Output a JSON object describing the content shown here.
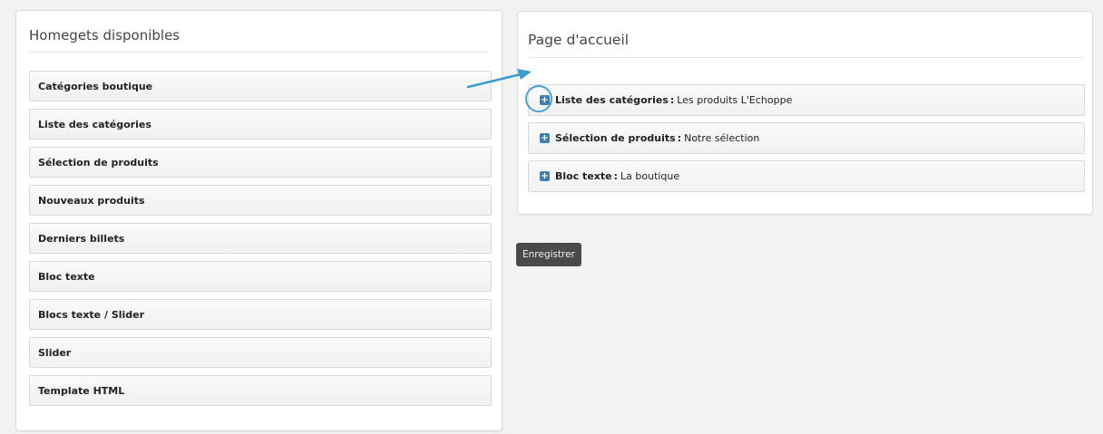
{
  "available_panel": {
    "title": "Homegets disponibles",
    "items": [
      {
        "label": "Catégories boutique"
      },
      {
        "label": "Liste des catégories"
      },
      {
        "label": "Sélection de produits"
      },
      {
        "label": "Nouveaux produits"
      },
      {
        "label": "Derniers billets"
      },
      {
        "label": "Bloc texte"
      },
      {
        "label": "Blocs texte / Slider"
      },
      {
        "label": "Slider"
      },
      {
        "label": "Template HTML"
      }
    ]
  },
  "home_panel": {
    "title": "Page d'accueil",
    "items": [
      {
        "type": "Liste des catégories",
        "sep": ":",
        "value": "Les produits L'Echoppe",
        "icon": "plus-square-icon"
      },
      {
        "type": "Sélection de produits",
        "sep": ":",
        "value": "Notre sélection",
        "icon": "plus-square-icon"
      },
      {
        "type": "Bloc texte",
        "sep": ":",
        "value": "La boutique",
        "icon": "plus-square-icon"
      }
    ]
  },
  "save_button": {
    "label": "Enregistrer"
  },
  "colors": {
    "accent": "#3d7fb8",
    "arrow": "#3a9bd1",
    "button_bg": "#4a4a4a"
  }
}
